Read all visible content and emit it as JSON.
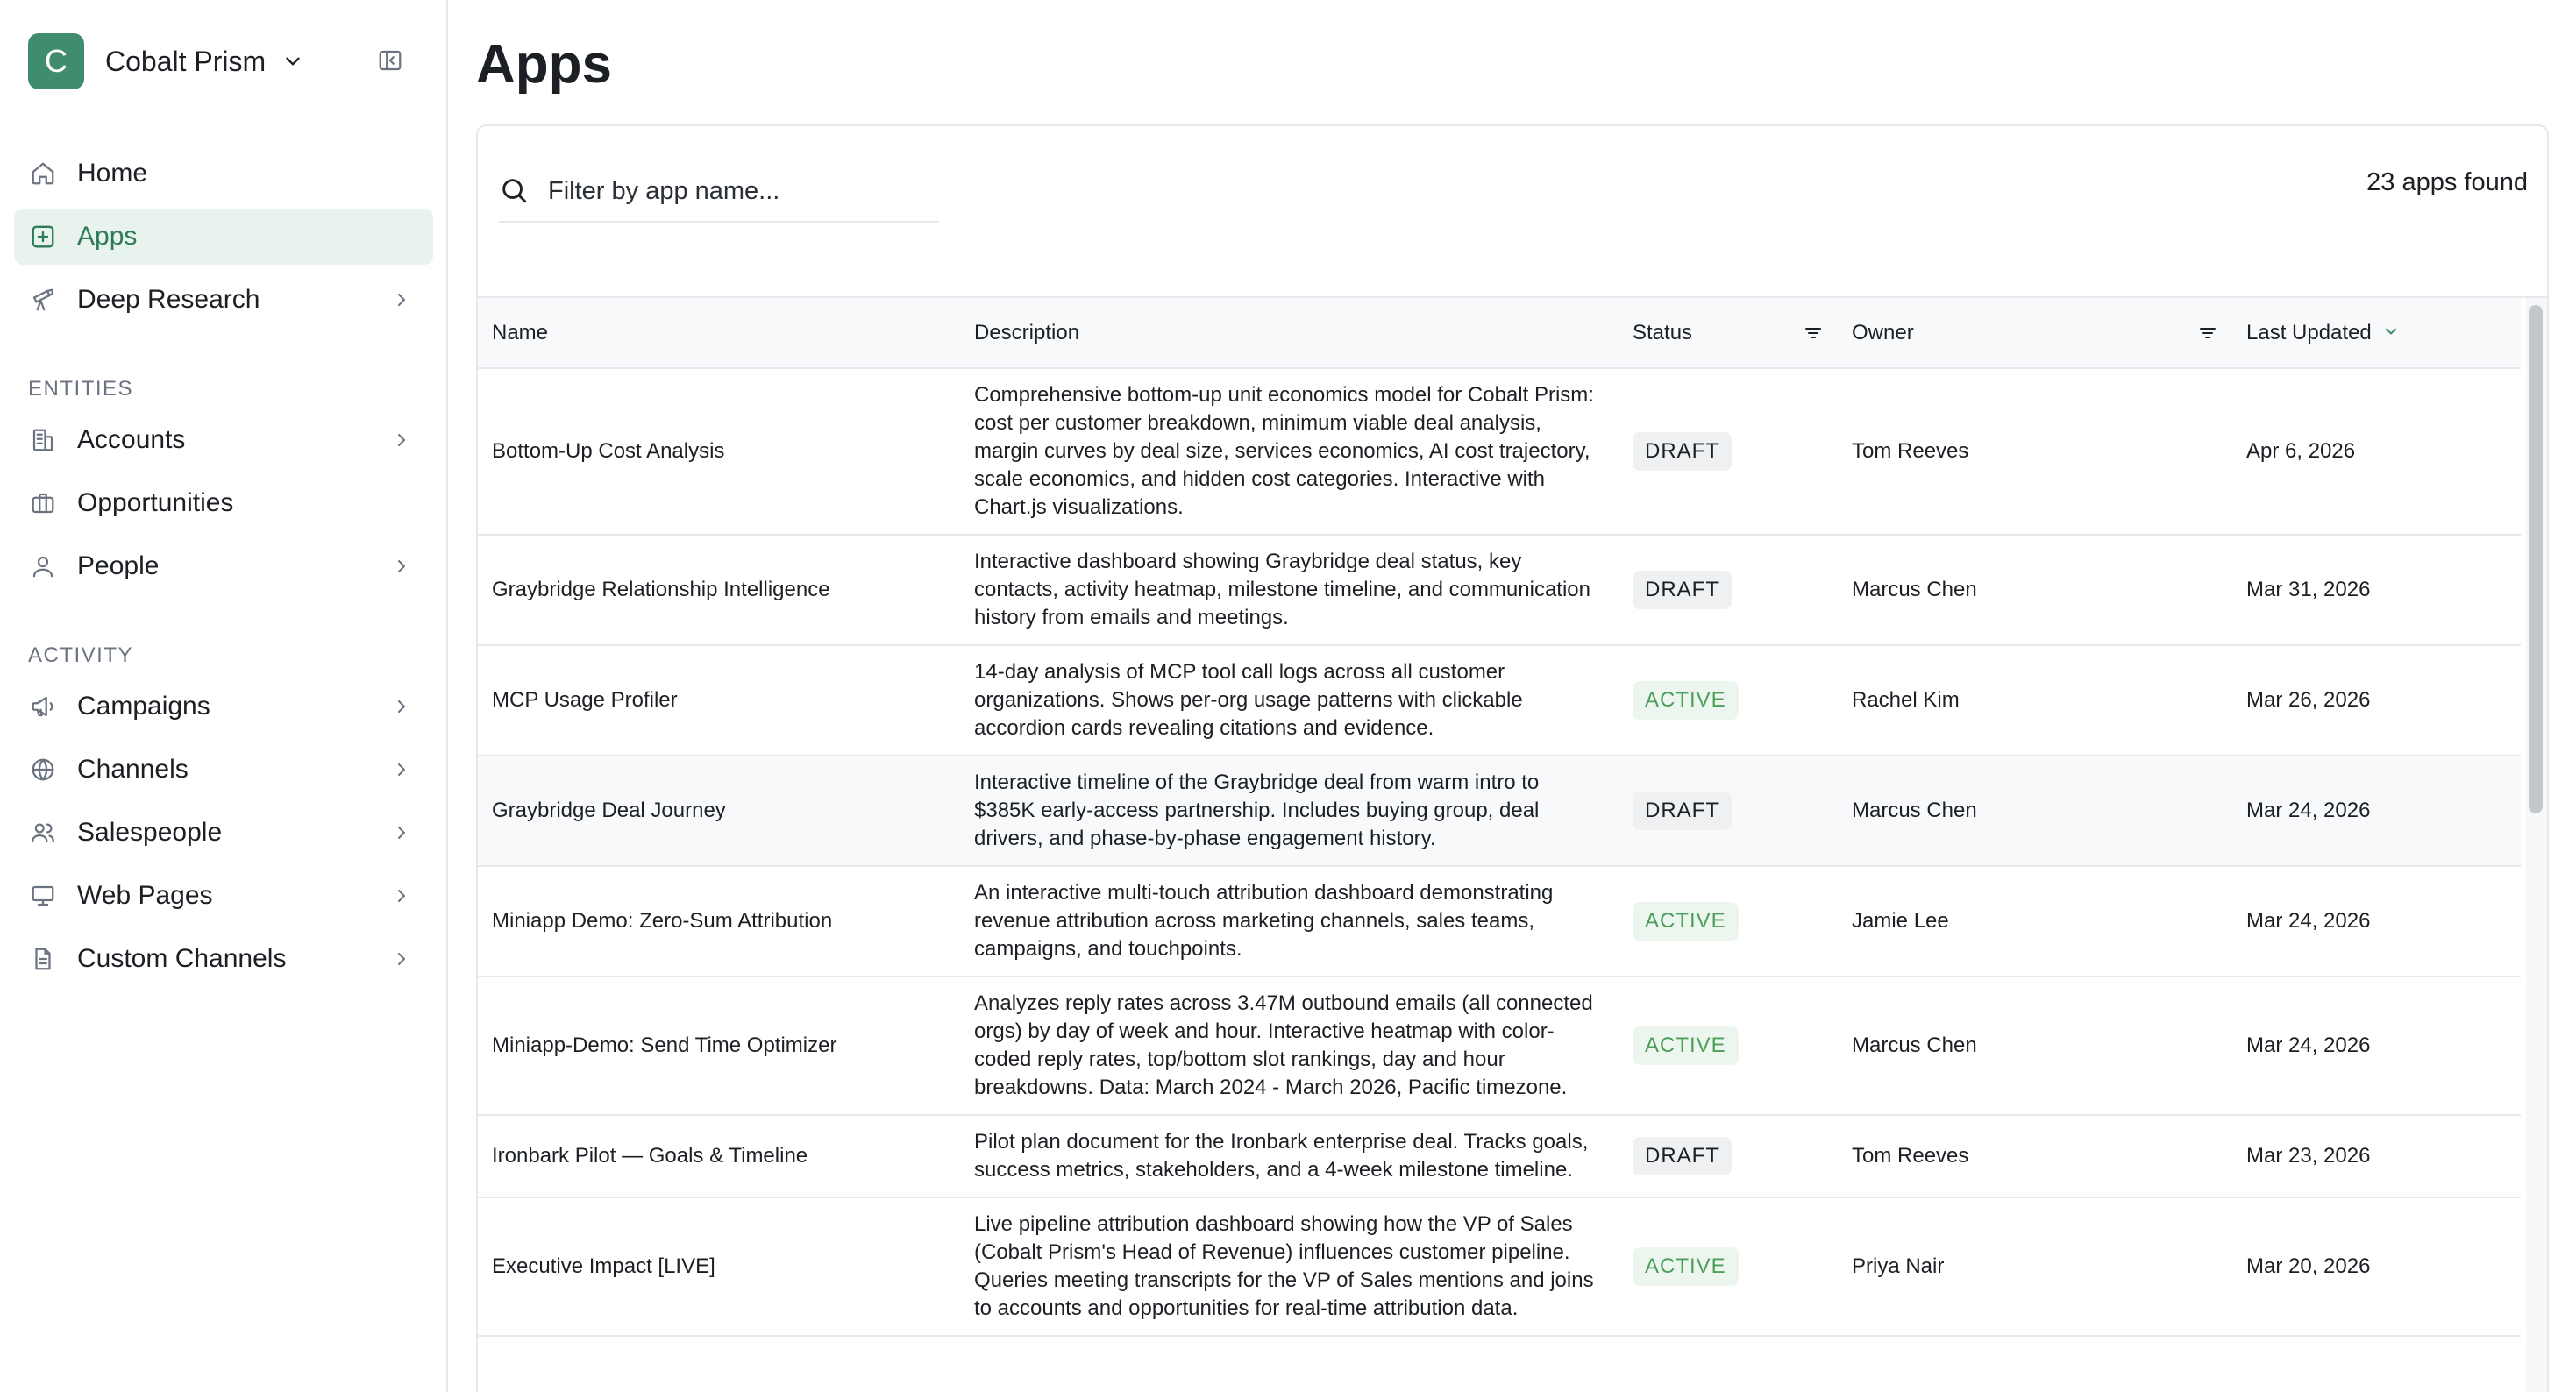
{
  "workspace": {
    "initial": "C",
    "name": "Cobalt Prism",
    "color": "#3f8c6e"
  },
  "nav": {
    "home": "Home",
    "apps": "Apps",
    "deep_research": "Deep Research",
    "entities_label": "ENTITIES",
    "accounts": "Accounts",
    "opportunities": "Opportunities",
    "people": "People",
    "activity_label": "ACTIVITY",
    "campaigns": "Campaigns",
    "channels": "Channels",
    "salespeople": "Salespeople",
    "web_pages": "Web Pages",
    "custom_channels": "Custom Channels"
  },
  "page": {
    "title": "Apps",
    "search_placeholder": "Filter by app name...",
    "count_text": "23 apps found"
  },
  "table": {
    "columns": {
      "name": "Name",
      "description": "Description",
      "status": "Status",
      "owner": "Owner",
      "last_updated": "Last Updated"
    },
    "rows": [
      {
        "name": "Bottom-Up Cost Analysis",
        "description": "Comprehensive bottom-up unit economics model for Cobalt Prism: cost per customer breakdown, minimum viable deal analysis, margin curves by deal size, services economics, AI cost trajectory, scale economics, and hidden cost categories. Interactive with Chart.js visualizations.",
        "status": "DRAFT",
        "owner": "Tom Reeves",
        "updated": "Apr 6, 2026"
      },
      {
        "name": "Graybridge Relationship Intelligence",
        "description": "Interactive dashboard showing Graybridge deal status, key contacts, activity heatmap, milestone timeline, and communication history from emails and meetings.",
        "status": "DRAFT",
        "owner": "Marcus Chen",
        "updated": "Mar 31, 2026"
      },
      {
        "name": "MCP Usage Profiler",
        "description": "14-day analysis of MCP tool call logs across all customer organizations. Shows per-org usage patterns with clickable accordion cards revealing citations and evidence.",
        "status": "ACTIVE",
        "owner": "Rachel Kim",
        "updated": "Mar 26, 2026"
      },
      {
        "name": "Graybridge Deal Journey",
        "description": "Interactive timeline of the Graybridge deal from warm intro to $385K early-access partnership. Includes buying group, deal drivers, and phase-by-phase engagement history.",
        "status": "DRAFT",
        "owner": "Marcus Chen",
        "updated": "Mar 24, 2026"
      },
      {
        "name": "Miniapp Demo: Zero-Sum Attribution",
        "description": "An interactive multi-touch attribution dashboard demonstrating revenue attribution across marketing channels, sales teams, campaigns, and touchpoints.",
        "status": "ACTIVE",
        "owner": "Jamie Lee",
        "updated": "Mar 24, 2026"
      },
      {
        "name": "Miniapp-Demo: Send Time Optimizer",
        "description": "Analyzes reply rates across 3.47M outbound emails (all connected orgs) by day of week and hour. Interactive heatmap with color-coded reply rates, top/bottom slot rankings, day and hour breakdowns. Data: March 2024 - March 2026, Pacific timezone.",
        "status": "ACTIVE",
        "owner": "Marcus Chen",
        "updated": "Mar 24, 2026"
      },
      {
        "name": "Ironbark Pilot — Goals & Timeline",
        "description": "Pilot plan document for the Ironbark enterprise deal. Tracks goals, success metrics, stakeholders, and a 4-week milestone timeline.",
        "status": "DRAFT",
        "owner": "Tom Reeves",
        "updated": "Mar 23, 2026"
      },
      {
        "name": "Executive Impact [LIVE]",
        "description": "Live pipeline attribution dashboard showing how the VP of Sales (Cobalt Prism's Head of Revenue) influences customer pipeline. Queries meeting transcripts for the VP of Sales mentions and joins to accounts and opportunities for real-time attribution data.",
        "status": "ACTIVE",
        "owner": "Priya Nair",
        "updated": "Mar 20, 2026"
      }
    ]
  }
}
